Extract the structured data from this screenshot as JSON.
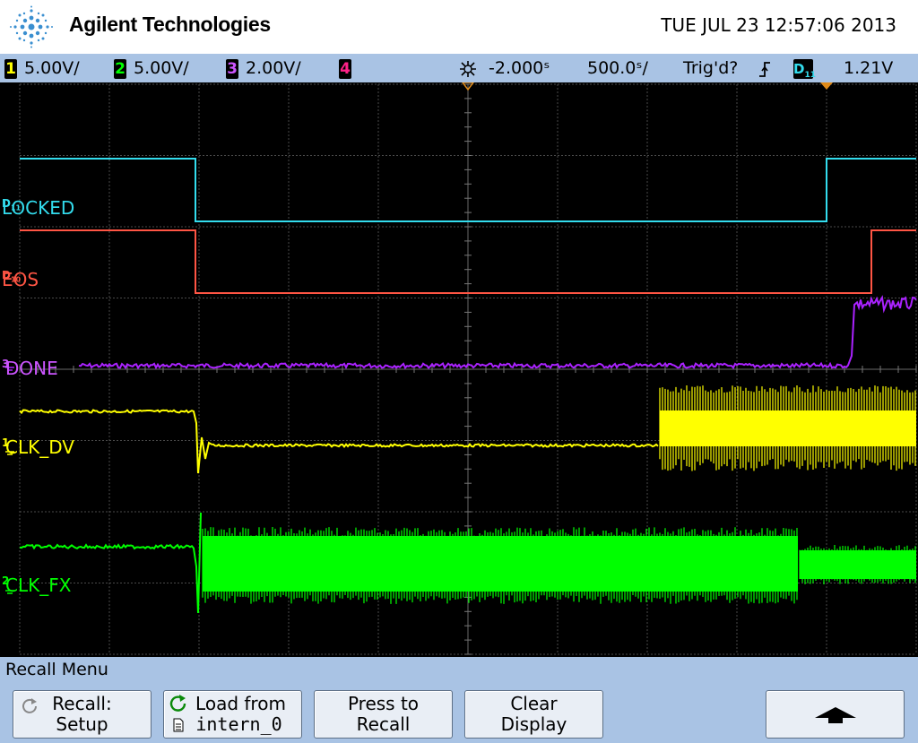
{
  "header": {
    "brand": "Agilent Technologies",
    "datetime": "TUE JUL 23 12:57:06 2013"
  },
  "status": {
    "ch1": {
      "num": "1",
      "scale": "5.00V/",
      "color": "#ffff00"
    },
    "ch2": {
      "num": "2",
      "scale": "5.00V/",
      "color": "#00ff00"
    },
    "ch3": {
      "num": "3",
      "scale": "2.00V/",
      "color": "#aa22ff"
    },
    "ch4": {
      "num": "4",
      "color": "#ff2288"
    },
    "delay": "-2.000ˢ",
    "timebase": "500.0ˢ/",
    "trigger_state": "Trig'd?",
    "trigger_source": "D",
    "trigger_source_sub": "11",
    "trigger_level": "1.21V"
  },
  "channels": {
    "locked": {
      "prefix": "D",
      "sub": "11",
      "label": "LOCKED",
      "color": "#33ddee"
    },
    "eos": {
      "prefix": "D",
      "sub": "10",
      "label": "EOS",
      "color": "#ff5544"
    },
    "done": {
      "prefix": "3",
      "label": "DONE",
      "color": "#aa22ff"
    },
    "clk_dv": {
      "prefix": "1",
      "label": "CLK_DV",
      "color": "#ffff00"
    },
    "clk_fx": {
      "prefix": "2",
      "label": "CLK_FX",
      "color": "#00ff00"
    }
  },
  "menu": {
    "title": "Recall Menu",
    "keys": [
      {
        "line1": "Recall:",
        "line2": "Setup"
      },
      {
        "line1": "Load from",
        "line2": "intern_0"
      },
      {
        "line1": "Press to",
        "line2": "Recall"
      },
      {
        "line1": "Clear",
        "line2": "Display"
      }
    ]
  },
  "icons": {
    "logo": "agilent-spark-icon",
    "delay": "delay-knob-icon",
    "trigger_edge": "rising-edge-icon",
    "recall": "recall-circular-arrow-icon",
    "load": "file-icon",
    "up": "up-arrow-icon"
  }
}
